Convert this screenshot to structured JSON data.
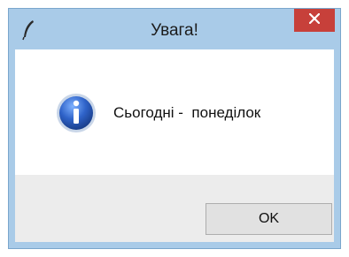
{
  "window": {
    "title": "Увага!"
  },
  "dialog": {
    "message": "Сьогодні -  понеділок",
    "ok_label": "OK",
    "icon": "info-icon"
  },
  "colors": {
    "titlebar": "#a9cbe8",
    "close_button": "#c7403a",
    "footer": "#ececec"
  }
}
